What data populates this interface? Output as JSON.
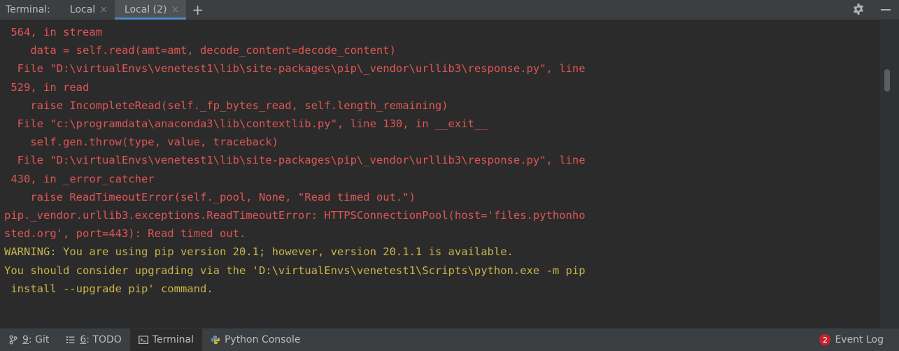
{
  "tabbar": {
    "title": "Terminal:",
    "tabs": [
      {
        "label": "Local",
        "close": "×"
      },
      {
        "label": "Local (2)",
        "close": "×"
      }
    ],
    "add": "+"
  },
  "terminal": {
    "lines": [
      {
        "text": " 564, in stream",
        "kind": "err"
      },
      {
        "text": "    data = self.read(amt=amt, decode_content=decode_content)",
        "kind": "err"
      },
      {
        "text": "  File \"D:\\virtualEnvs\\venetest1\\lib\\site-packages\\pip\\_vendor\\urllib3\\response.py\", line",
        "kind": "err"
      },
      {
        "text": " 529, in read",
        "kind": "err"
      },
      {
        "text": "    raise IncompleteRead(self._fp_bytes_read, self.length_remaining)",
        "kind": "err"
      },
      {
        "text": "  File \"c:\\programdata\\anaconda3\\lib\\contextlib.py\", line 130, in __exit__",
        "kind": "err"
      },
      {
        "text": "    self.gen.throw(type, value, traceback)",
        "kind": "err"
      },
      {
        "text": "  File \"D:\\virtualEnvs\\venetest1\\lib\\site-packages\\pip\\_vendor\\urllib3\\response.py\", line",
        "kind": "err"
      },
      {
        "text": " 430, in _error_catcher",
        "kind": "err"
      },
      {
        "text": "    raise ReadTimeoutError(self._pool, None, \"Read timed out.\")",
        "kind": "err"
      },
      {
        "text": "pip._vendor.urllib3.exceptions.ReadTimeoutError: HTTPSConnectionPool(host='files.pythonho",
        "kind": "err"
      },
      {
        "text": "sted.org', port=443): Read timed out.",
        "kind": "err"
      },
      {
        "text": "WARNING: You are using pip version 20.1; however, version 20.1.1 is available.",
        "kind": "warn"
      },
      {
        "text": "You should consider upgrading via the 'D:\\virtualEnvs\\venetest1\\Scripts\\python.exe -m pip",
        "kind": "warn"
      },
      {
        "text": " install --upgrade pip' command.",
        "kind": "warn"
      }
    ]
  },
  "statusbar": {
    "git": {
      "num": "9",
      "label": ": Git"
    },
    "todo": {
      "num": "6",
      "label": ": TODO"
    },
    "terminal": "Terminal",
    "python_console": "Python Console",
    "event_log": "Event Log",
    "event_count": "2"
  },
  "icons": {
    "settings": "gear-icon",
    "hide": "minus-icon",
    "git": "git-branch-icon",
    "todo": "list-icon",
    "terminal": "terminal-icon",
    "python": "python-icon"
  },
  "colors": {
    "error": "#e05555",
    "warning": "#c9b44a",
    "accent": "#4a88c7",
    "badge": "#c7222d"
  }
}
